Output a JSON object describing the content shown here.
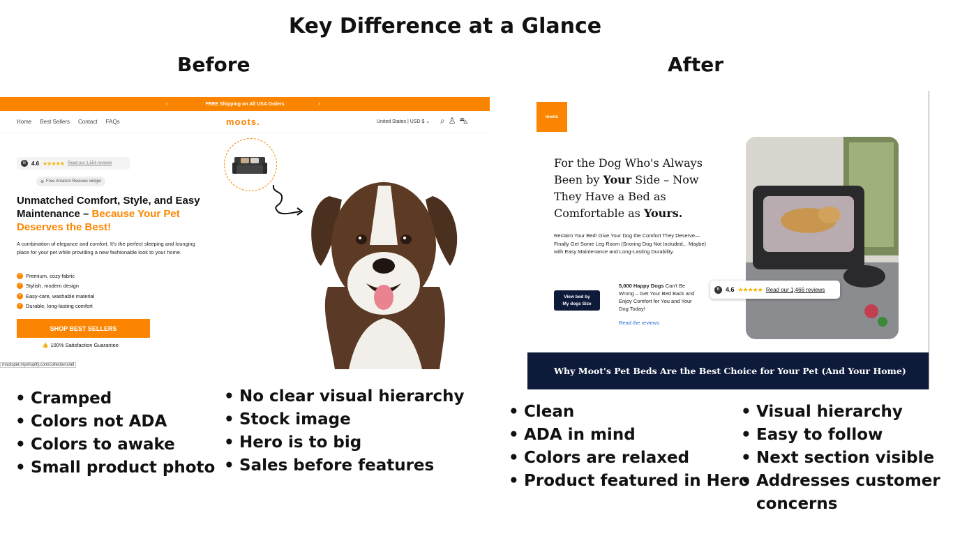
{
  "title": "Key Difference at a Glance",
  "before_label": "Before",
  "after_label": "After",
  "before_site": {
    "banner": "FREE Shipping on All USA Orders",
    "nav": [
      "Home",
      "Best Sellers",
      "Contact",
      "FAQs"
    ],
    "logo": "moots.",
    "locale": "United States | USD $",
    "rating": "4.6",
    "reviews_link": "Read our 1,554 reviews",
    "widget": "Free Amazon Reviews widget",
    "headline_main": "Unmatched Comfort, Style, and Easy Maintenance – ",
    "headline_highlight": "Because Your Pet Deserves the Best!",
    "description": "A combination of elegance and comfort. It's the perfect sleeping and lounging place for your pet while providing a new fashionable look to your home.",
    "features": [
      "Premium, cozy fabric",
      "Stylish, modern design",
      "Easy-care, washable material",
      "Durable, long-lasting comfort"
    ],
    "cta": "SHOP BEST SELLERS",
    "guarantee": "100% Satisfaction Guarantee",
    "status_url": "mootspet.myshopify.com/collections/all"
  },
  "after_site": {
    "logo": "moots",
    "headline_1": "For the Dog Who's Always Been by ",
    "headline_bold_1": "Your",
    "headline_2": " Side – Now They Have a Bed as Comfortable as ",
    "headline_bold_2": "Yours.",
    "description": "Reclaim Your Bed! Give Your Dog the Comfort They Deserve—Finally Get Some Leg Room (Snoring Dog Not Included... Maybe) with Easy Maintenance and Long-Lasting Durability.",
    "cta_line1": "View bed by",
    "cta_line2": "My dogs Size",
    "happy_bold": "5,000 Happy Dogs",
    "happy_rest": " Can't Be Wrong – Get Your Bed Back and Enjoy Comfort for You and Your Dog Today!",
    "read_reviews": "Read the reviews",
    "rating": "4.6",
    "reviews_link": "Read our 1,466 reviews",
    "next_section": "Why Moot's Pet Beds Are the Best Choice for Your Pet (And Your Home)"
  },
  "before_notes_left": [
    "Cramped",
    "Colors not ADA",
    "Colors to awake",
    "Small product photo"
  ],
  "before_notes_right": [
    "No clear visual hierarchy",
    "Stock image",
    "Hero is to big",
    "Sales before features"
  ],
  "after_notes_left": [
    "Clean",
    "ADA in mind",
    "Colors are relaxed",
    "Product featured in Hero"
  ],
  "after_notes_right": [
    "Visual hierarchy",
    "Easy to follow",
    "Next section visible",
    "Addresses customer concerns"
  ],
  "colors": {
    "brand_orange": "#fb8500",
    "navy": "#0e1a3a",
    "star": "#f5b301",
    "link_blue": "#2a6bd6"
  }
}
